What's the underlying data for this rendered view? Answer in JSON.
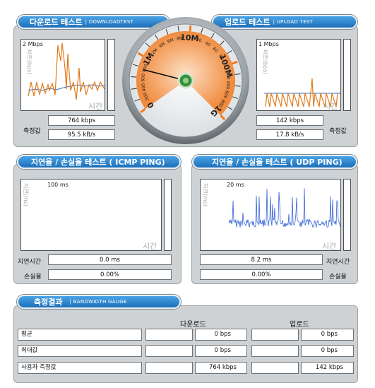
{
  "download": {
    "title": "다운로드 테스트",
    "sub": "DOWNLOADTEST",
    "scale": "2 Mbps",
    "ylabel": "비트(bps)",
    "time": "시간",
    "speed": "764 kbps",
    "rate": "95.5 kB/s",
    "measure_label": "측정값"
  },
  "upload": {
    "title": "업로드 테스트",
    "sub": "UPLOAD TEST",
    "scale": "1 Mbps",
    "ylabel": "비트(bps)",
    "time": "시간",
    "speed": "142 kbps",
    "rate": "17.8 kB/s",
    "measure_label": "측정값"
  },
  "gauge": {
    "labels": [
      "0",
      "200",
      "400",
      "600",
      "800",
      "1M",
      "2M",
      "4M",
      "6M",
      "8M",
      "10M",
      "20",
      "40",
      "60",
      "80",
      "100M",
      "200",
      "400",
      "600",
      "800",
      "1G"
    ],
    "needle_value": "764 kbps",
    "colors": {
      "accent": "#f07a1c",
      "fill": "#f6b27a"
    }
  },
  "icmp": {
    "title": "지연율 / 손실율 테스트 ( ICMP PING)",
    "scale": "100 ms",
    "ylabel": "지연(ms)",
    "time": "시간",
    "delay_label": "지연시간",
    "delay": "0.0 ms",
    "loss_label": "손실율",
    "loss": "0.00%"
  },
  "udp": {
    "title": "지연율 / 손실율 테스트 ( UDP PING)",
    "scale": "20 ms",
    "ylabel": "지연(ms)",
    "time": "시간",
    "delay_label": "지연시간",
    "delay": "8.2 ms",
    "loss_label": "손실율",
    "loss": "0.00%"
  },
  "results": {
    "title": "측정결과",
    "sub": "BANDWIDTH GAUGE",
    "col_download": "다운로드",
    "col_upload": "업로드",
    "rows": [
      {
        "label": "평균",
        "down": "0 bps",
        "up": "0 bps"
      },
      {
        "label": "최대값",
        "down": "0 bps",
        "up": "0 bps"
      },
      {
        "label": "사용자 측정값",
        "down": "764 kbps",
        "up": "142 kbps"
      }
    ]
  }
}
